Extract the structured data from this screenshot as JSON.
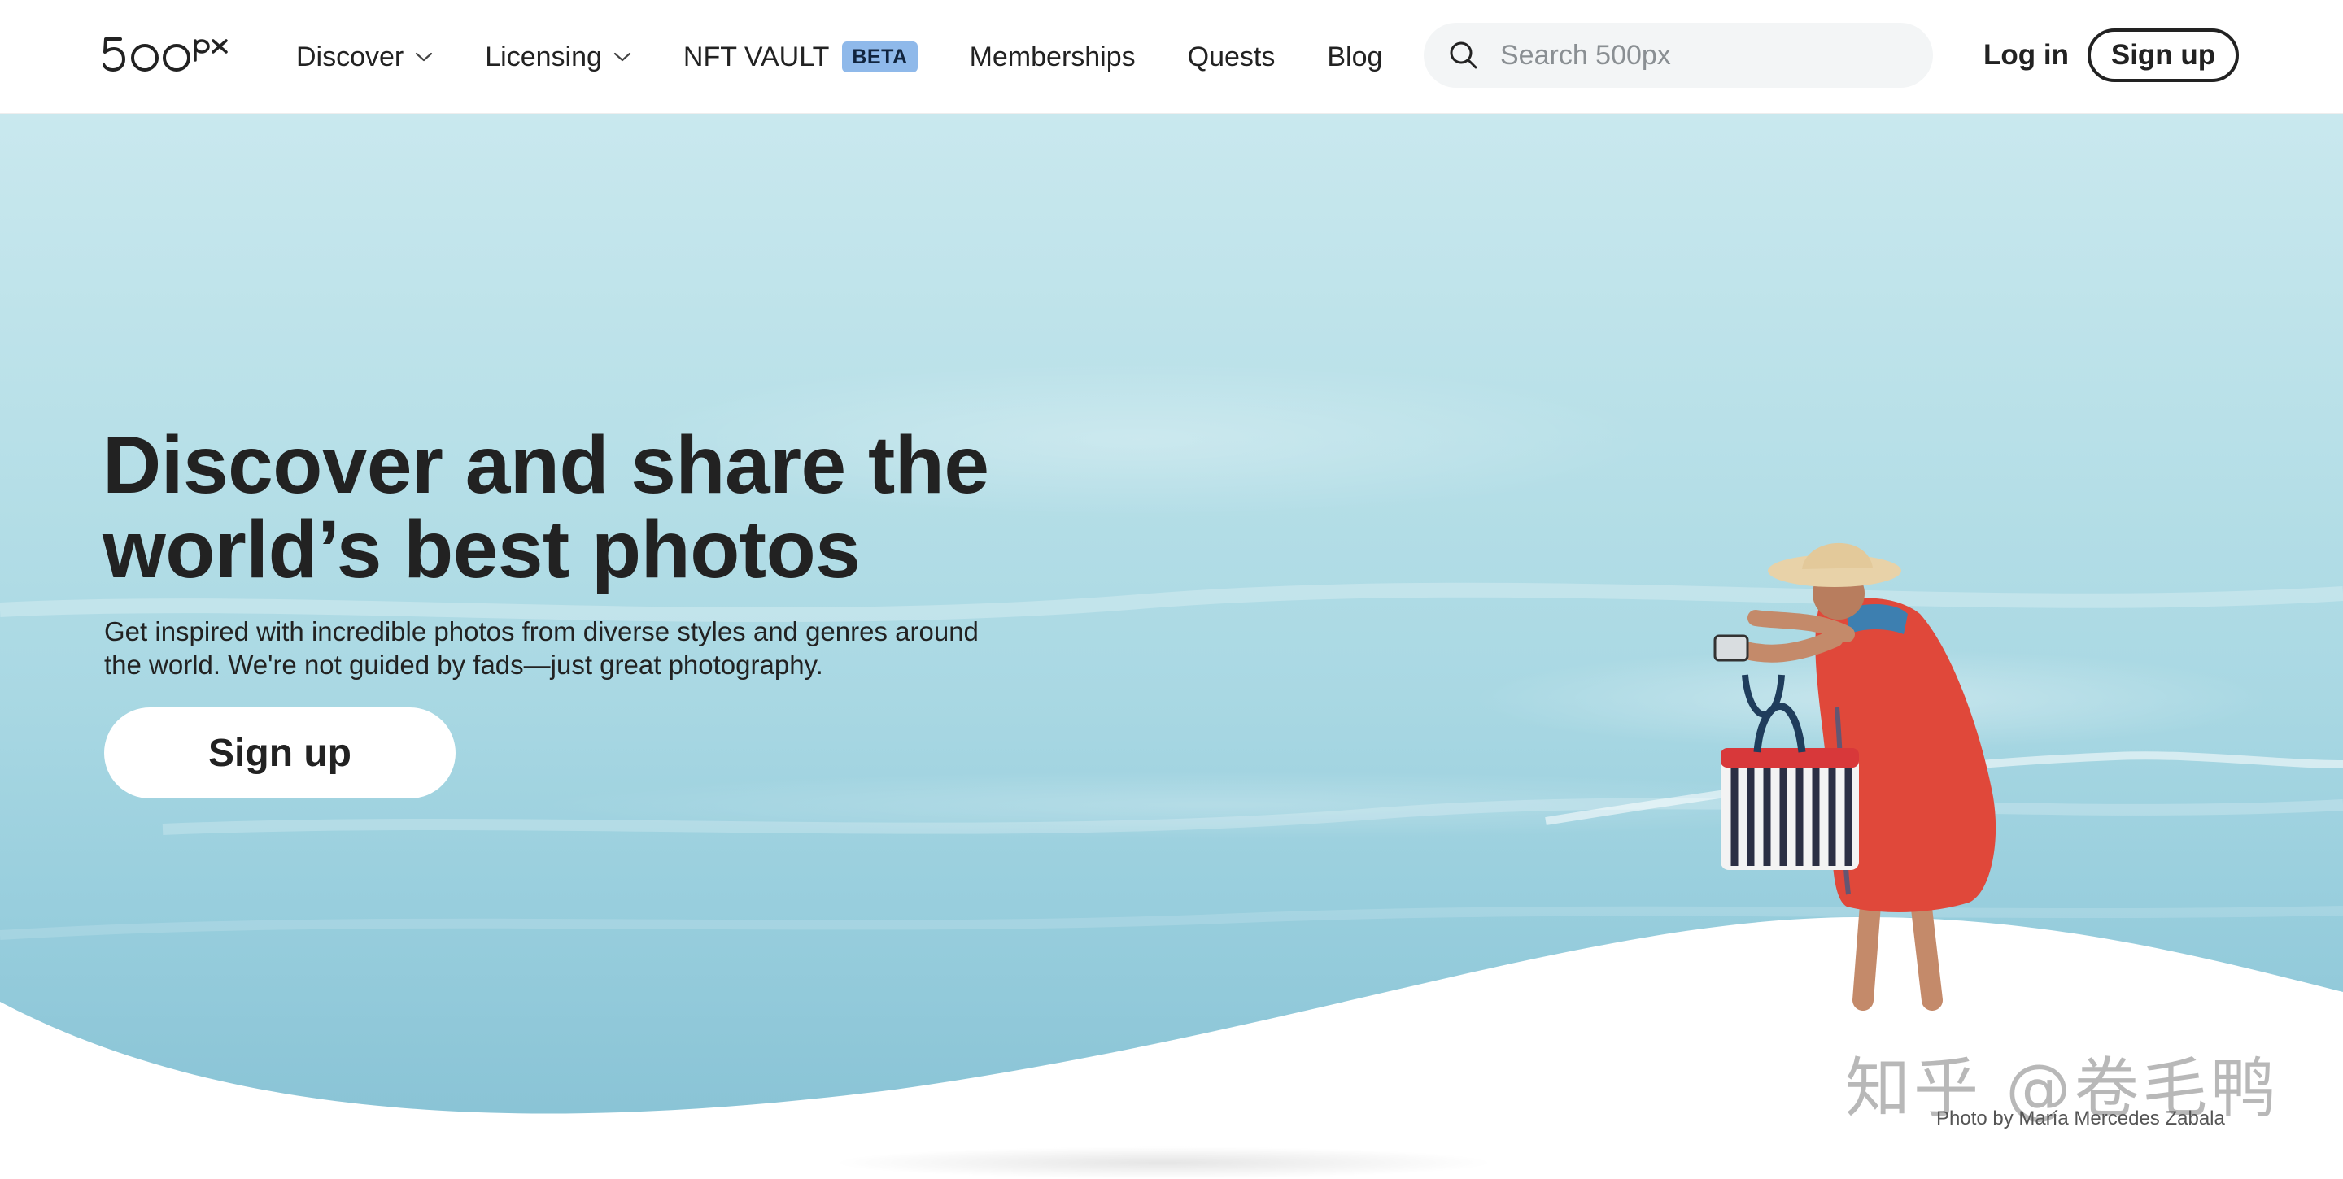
{
  "brand": {
    "logo_text": "500px"
  },
  "nav": {
    "items": [
      {
        "label": "Discover",
        "dropdown": true
      },
      {
        "label": "Licensing",
        "dropdown": true
      },
      {
        "label": "NFT VAULT",
        "badge": "BETA"
      },
      {
        "label": "Memberships"
      },
      {
        "label": "Quests"
      },
      {
        "label": "Blog"
      }
    ]
  },
  "search": {
    "placeholder": "Search 500px"
  },
  "auth": {
    "login_label": "Log in",
    "signup_label": "Sign up"
  },
  "hero": {
    "headline_line1": "Discover and share the",
    "headline_line2": "world’s best photos",
    "subtext_line1": "Get inspired with incredible photos from diverse styles and genres around",
    "subtext_line2": "the world. We're not guided by fads—just great photography.",
    "cta_label": "Sign up",
    "photo_credit": "Photo by María Mercedes Zabala"
  },
  "watermark": {
    "text": "知乎 @卷毛鸭"
  },
  "colors": {
    "text": "#222222",
    "badge_bg": "#8fb9ea",
    "search_bg": "#f3f5f6",
    "sea_light": "#c9e8ee",
    "sea_dark": "#86c1d4",
    "dress": "#e0483a"
  },
  "icons": {
    "search": "search-icon",
    "dropdown": "chevron-down-icon"
  }
}
